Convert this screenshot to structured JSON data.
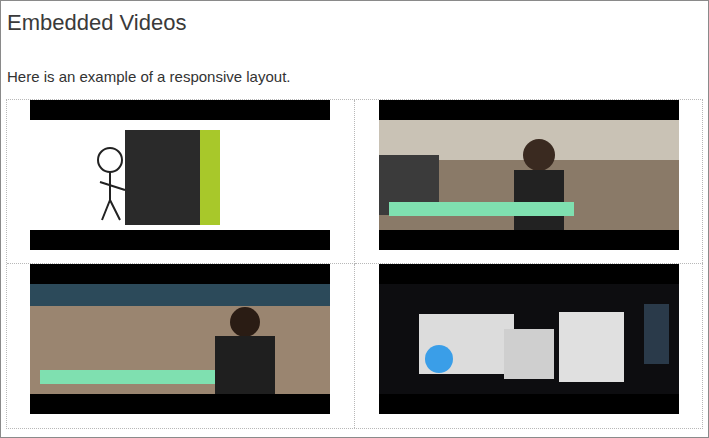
{
  "page": {
    "title": "Embedded Videos",
    "intro": "Here is an example of a responsive layout."
  }
}
